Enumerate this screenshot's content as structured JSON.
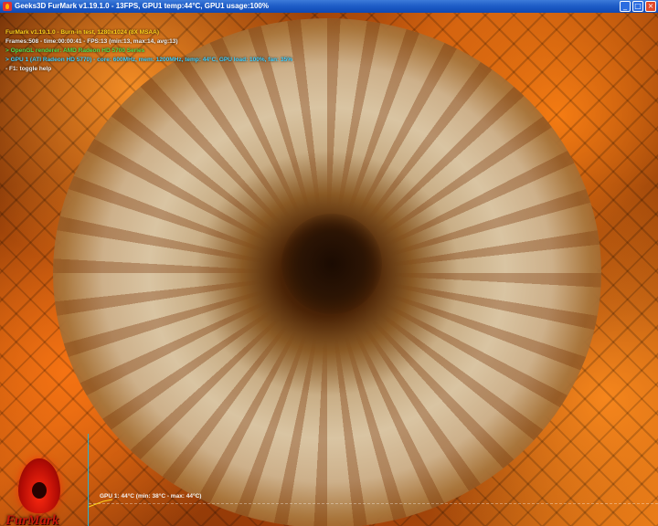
{
  "window": {
    "title": "Geeks3D FurMark v1.19.1.0 - 13FPS, GPU1 temp:44°C, GPU1 usage:100%",
    "buttons": [
      "_",
      "□",
      "×"
    ]
  },
  "hud": {
    "line1": "FurMark v1.19.1.0 - Burn-in test, 1280x1024 (8X MSAA)",
    "line2": "Frames:508 - time:00:00:41 - FPS:13 (min:13, max:14, avg:13)",
    "line3": "> OpenGL renderer: AMD Radeon HD 5700 Series",
    "line4": "> GPU 1 (ATI Radeon HD 5770) - core: 600MHz, mem: 1200MHz, temp: 44°C, GPU load: 100%, fan: 35%",
    "line5": "- F1: toggle help"
  },
  "temp_graph": {
    "label": "GPU 1: 44°C (min: 38°C - max: 44°C)"
  },
  "logo": {
    "text": "FurMark"
  },
  "colors": {
    "hud_title": "#ffd21c",
    "hud_renderer": "#4fe04f",
    "hud_gpu": "#3fd0ff",
    "graph_axis": "#2ab0c8"
  }
}
